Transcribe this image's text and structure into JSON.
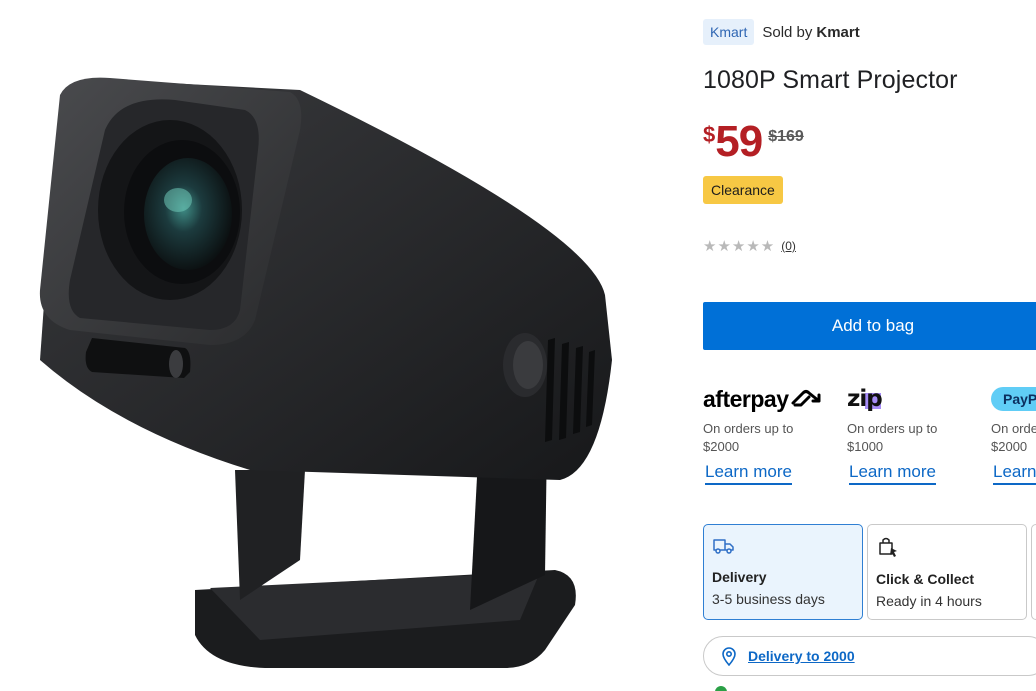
{
  "seller": {
    "chip": "Kmart",
    "sold_by_prefix": "Sold by",
    "sold_by_name": "Kmart"
  },
  "product": {
    "title": "1080P Smart Projector",
    "price_currency": "$",
    "price": "59",
    "was_price": "$169",
    "badge": "Clearance",
    "rating_stars": "★★★★★",
    "rating_count": "(0)",
    "rating_value": 0
  },
  "actions": {
    "add_to_bag": "Add to bag"
  },
  "payment_options": [
    {
      "brand": "afterpay",
      "logo_icon": "afterpay-loop-icon",
      "desc_line1": "On orders up to",
      "desc_line2": "$2000",
      "link": "Learn more"
    },
    {
      "brand": "zip",
      "desc_line1": "On orders up to",
      "desc_line2": "$1000",
      "link": "Learn more"
    },
    {
      "brand": "PayP",
      "desc_line1": "On orde",
      "desc_line2": "$2000",
      "link": "Learn"
    }
  ],
  "fulfilment": {
    "delivery": {
      "icon": "truck-icon",
      "title": "Delivery",
      "sub": "3-5 business days"
    },
    "click_collect": {
      "icon": "shopping-bag-icon",
      "title": "Click & Collect",
      "sub": "Ready in 4 hours"
    },
    "delivery_to": {
      "icon": "location-pin-icon",
      "text": "Delivery to 2000"
    }
  },
  "colors": {
    "primary_blue": "#0070d7",
    "price_red": "#b41f24",
    "clearance_yellow": "#f7c844",
    "link_blue": "#0d68c6",
    "selected_bg": "#eaf4fd"
  }
}
